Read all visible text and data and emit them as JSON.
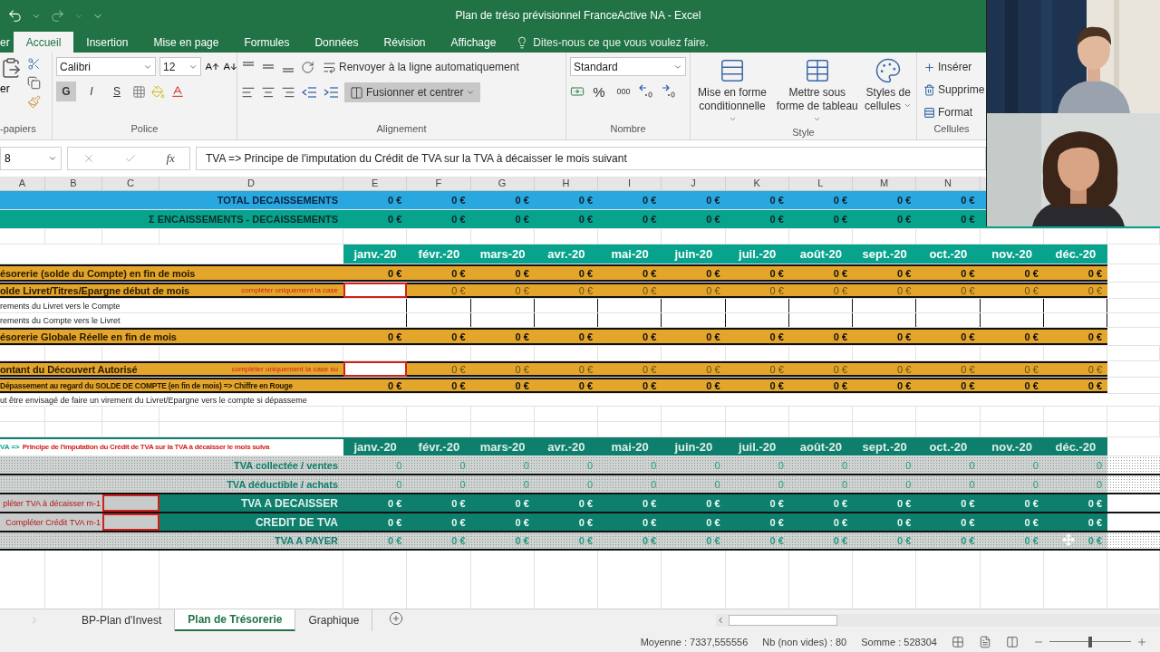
{
  "window": {
    "title": "Plan de tréso prévisionnel FranceActive NA - Excel"
  },
  "ribbon_tabs": [
    {
      "label": "er",
      "selected": false
    },
    {
      "label": "Accueil",
      "selected": true
    },
    {
      "label": "Insertion",
      "selected": false
    },
    {
      "label": "Mise en page",
      "selected": false
    },
    {
      "label": "Formules",
      "selected": false
    },
    {
      "label": "Données",
      "selected": false
    },
    {
      "label": "Révision",
      "selected": false
    },
    {
      "label": "Affichage",
      "selected": false
    }
  ],
  "tell_me": "Dites-nous ce que vous voulez faire.",
  "ribbon": {
    "clipboard": {
      "paste": "er",
      "group": "-papiers"
    },
    "font": {
      "name": "Calibri",
      "size": "12",
      "bold": "G",
      "italic": "I",
      "underline": "S",
      "group": "Police"
    },
    "alignment": {
      "wrap": "Renvoyer à la ligne automatiquement",
      "merge": "Fusionner et centrer",
      "group": "Alignement"
    },
    "number": {
      "format": "Standard",
      "percent": "%",
      "thousands": "000",
      "group": "Nombre"
    },
    "style": {
      "buttons": [
        "Mise en forme conditionnelle",
        "Mettre sous forme de tableau",
        "Styles de cellules"
      ],
      "group": "Style"
    },
    "cells": {
      "buttons": [
        "Insérer",
        "Supprime",
        "Format"
      ],
      "group": "Cellules"
    }
  },
  "formula_bar": {
    "name_box": "8",
    "fx": "fx",
    "formula": "TVA => Principe de l'imputation du Crédit de TVA sur la TVA à décaisser le mois suivant"
  },
  "sheet": {
    "columns": [
      "A",
      "B",
      "C",
      "D",
      "E",
      "F",
      "G",
      "H",
      "I",
      "J",
      "K",
      "L",
      "M",
      "N"
    ],
    "rows": [
      {
        "kind": "total",
        "label": "TOTAL DECAISSEMENTS",
        "values": [
          "0 €",
          "0 €",
          "0 €",
          "0 €",
          "0 €",
          "0 €",
          "0 €",
          "0 €",
          "0 €",
          "0 €"
        ]
      },
      {
        "kind": "net",
        "label": "Σ ENCAISSEMENTS - DECAISSEMENTS",
        "values": [
          "0 €",
          "0 €",
          "0 €",
          "0 €",
          "0 €",
          "0 €",
          "0 €",
          "0 €",
          "0 €",
          "0 €"
        ]
      },
      {
        "kind": "blank"
      },
      {
        "kind": "months",
        "values": [
          "janv.-20",
          "févr.-20",
          "mars-20",
          "avr.-20",
          "mai-20",
          "juin-20",
          "juil.-20",
          "août-20",
          "sept.-20",
          "oct.-20",
          "nov.-20",
          "déc.-20"
        ]
      },
      {
        "kind": "gold",
        "label": "ésorerie (solde du Compte) en fin de mois",
        "values": [
          "0 €",
          "0 €",
          "0 €",
          "0 €",
          "0 €",
          "0 €",
          "0 €",
          "0 €",
          "0 €",
          "0 €",
          "0 €",
          "0 €"
        ]
      },
      {
        "kind": "gold_input",
        "label": "olde Livret/Titres/Epargne début de mois",
        "note": "compléter uniquement la case",
        "values": [
          "0 €",
          "0 €",
          "0 €",
          "0 €",
          "0 €",
          "0 €",
          "0 €",
          "0 €",
          "0 €",
          "0 €",
          "0 €"
        ]
      },
      {
        "kind": "plain",
        "label": "rements du Livret vers le Compte"
      },
      {
        "kind": "plain",
        "label": "rements du Compte vers le Livret"
      },
      {
        "kind": "gold",
        "label": "ésorerie Globale Réelle en fin de mois",
        "values": [
          "0 €",
          "0 €",
          "0 €",
          "0 €",
          "0 €",
          "0 €",
          "0 €",
          "0 €",
          "0 €",
          "0 €",
          "0 €",
          "0 €"
        ]
      },
      {
        "kind": "blank"
      },
      {
        "kind": "gold_input",
        "label": "ontant du Découvert Autorisé",
        "note": "compléter uniquement la case su",
        "values": [
          "0 €",
          "0 €",
          "0 €",
          "0 €",
          "0 €",
          "0 €",
          "0 €",
          "0 €",
          "0 €",
          "0 €",
          "0 €"
        ]
      },
      {
        "kind": "gold_small",
        "label": "Dépassement au regard du SOLDE DE COMPTE (en fin de mois) => Chiffre en Rouge",
        "values": [
          "0 €",
          "0 €",
          "0 €",
          "0 €",
          "0 €",
          "0 €",
          "0 €",
          "0 €",
          "0 €",
          "0 €",
          "0 €",
          "0 €"
        ]
      },
      {
        "kind": "note",
        "label": "ut être envisagé de faire un virement du Livret/Epargne vers le compte si dépasseme"
      },
      {
        "kind": "blank"
      },
      {
        "kind": "blank"
      },
      {
        "kind": "tva_header",
        "prefix": "VA =>",
        "label": "Principe de l'imputation du Crédit de TVA sur la TVA à décaisser le mois suiva",
        "values": [
          "janv.-20",
          "févr.-20",
          "mars-20",
          "avr.-20",
          "mai-20",
          "juin-20",
          "juil.-20",
          "août-20",
          "sept.-20",
          "oct.-20",
          "nov.-20",
          "déc.-20"
        ]
      },
      {
        "kind": "tva_dotted",
        "label": "TVA collectée / ventes",
        "values": [
          "0",
          "0",
          "0",
          "0",
          "0",
          "0",
          "0",
          "0",
          "0",
          "0",
          "0",
          "0"
        ]
      },
      {
        "kind": "tva_dotted",
        "label": "TVA déductible / achats",
        "values": [
          "0",
          "0",
          "0",
          "0",
          "0",
          "0",
          "0",
          "0",
          "0",
          "0",
          "0",
          "0"
        ]
      },
      {
        "kind": "tva_teal",
        "note": "pléter TVA à décaisser m-1",
        "label": "TVA A DECAISSER",
        "values": [
          "0 €",
          "0 €",
          "0 €",
          "0 €",
          "0 €",
          "0 €",
          "0 €",
          "0 €",
          "0 €",
          "0 €",
          "0 €",
          "0 €"
        ]
      },
      {
        "kind": "tva_teal",
        "note": "Compléter Crédit TVA m-1",
        "label": "CREDIT DE TVA",
        "values": [
          "0 €",
          "0 €",
          "0 €",
          "0 €",
          "0 €",
          "0 €",
          "0 €",
          "0 €",
          "0 €",
          "0 €",
          "0 €",
          "0 €"
        ]
      },
      {
        "kind": "tva_total",
        "label": "TVA A PAYER",
        "values": [
          "0 €",
          "0 €",
          "0 €",
          "0 €",
          "0 €",
          "0 €",
          "0 €",
          "0 €",
          "0 €",
          "0 €",
          "0 €",
          "0 €"
        ]
      }
    ]
  },
  "sheet_tabs": [
    {
      "label": "BP-Plan d'Invest",
      "selected": false
    },
    {
      "label": "Plan de Trésorerie",
      "selected": true
    },
    {
      "label": "Graphique",
      "selected": false
    }
  ],
  "status_bar": {
    "average": "Moyenne : 7337,555556",
    "count": "Nb (non vides) : 80",
    "sum": "Somme : 528304",
    "zoom_slider": {
      "level": 0.5
    }
  }
}
